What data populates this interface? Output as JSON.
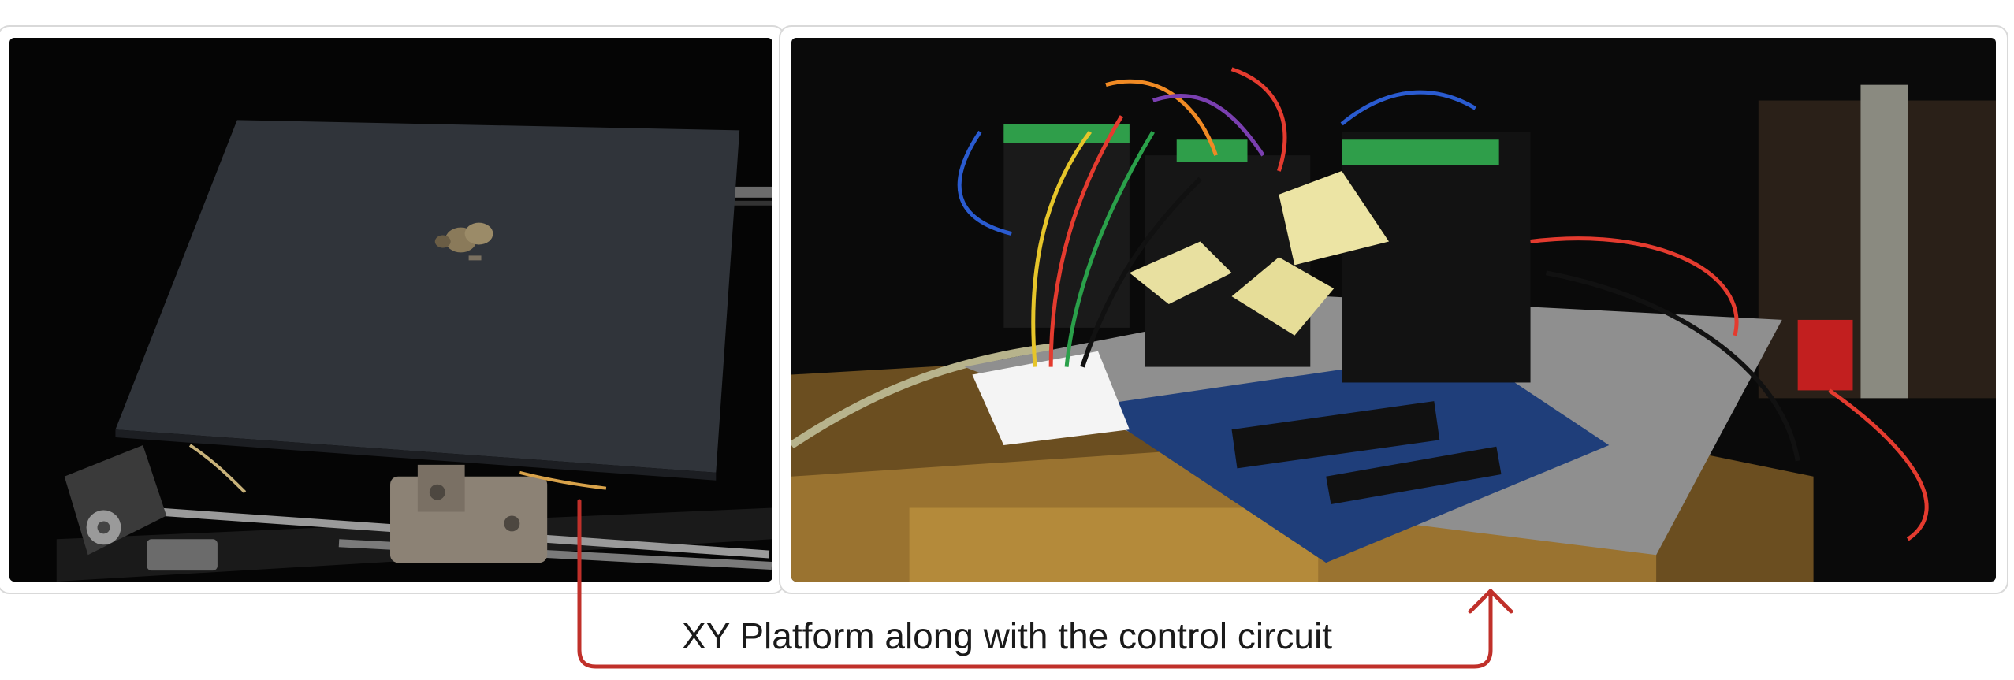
{
  "caption": "XY Platform along with the control circuit",
  "colors": {
    "arrow": "#c0302a",
    "panel_border": "#d9d9d9",
    "background": "#ffffff"
  },
  "photos": [
    {
      "label": "xy-platform"
    },
    {
      "label": "control-circuit"
    }
  ]
}
